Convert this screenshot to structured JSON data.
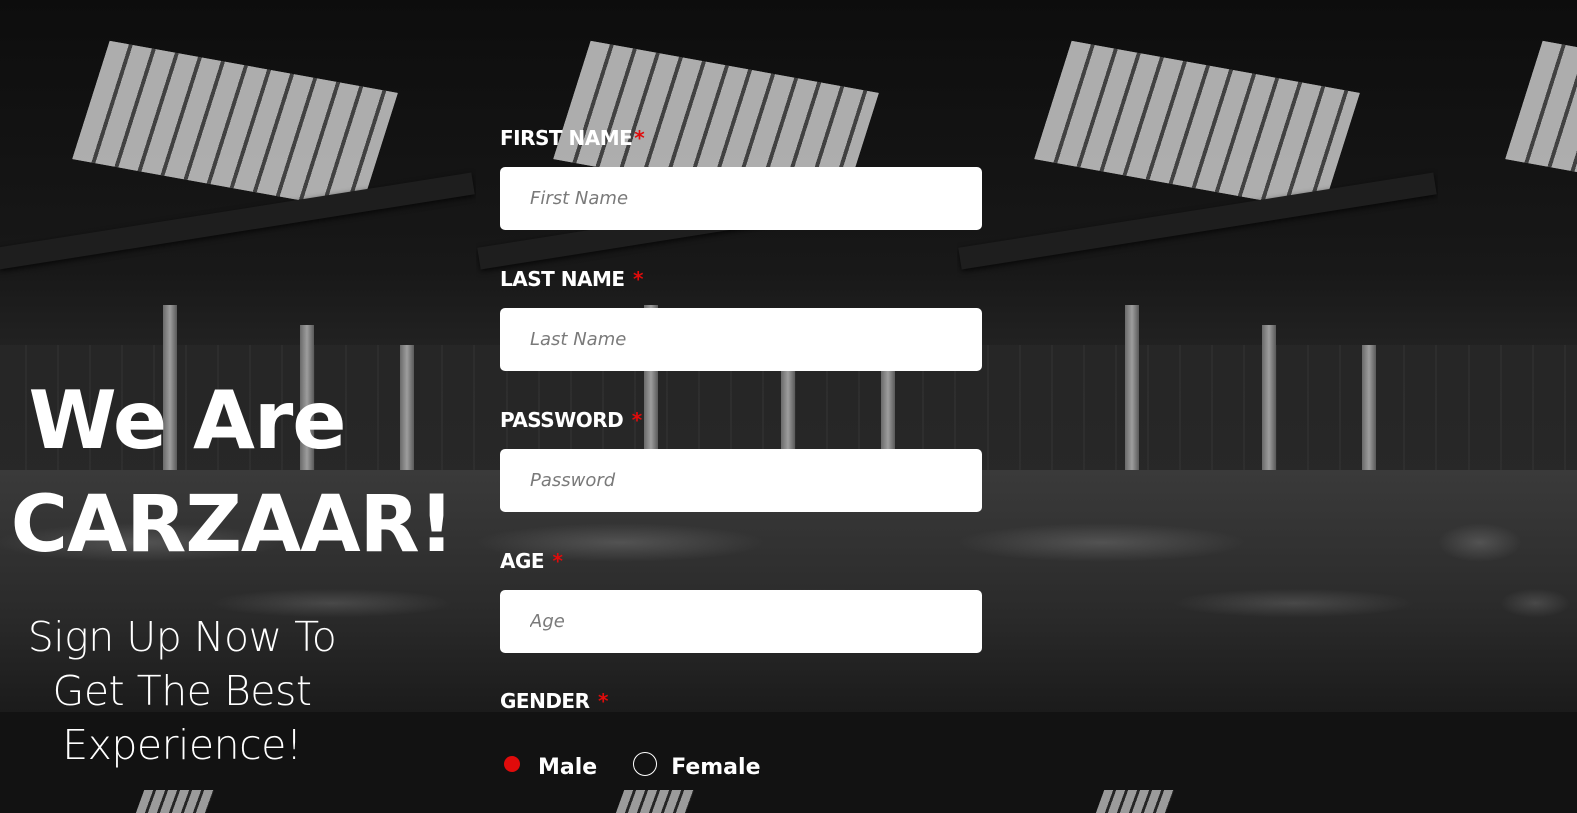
{
  "hero": {
    "title_line1": "We Are",
    "title_line2": "CARZAAR!",
    "subtitle_line1": "Sign Up Now To",
    "subtitle_line2": "Get The Best",
    "subtitle_line3": "Experience!"
  },
  "form": {
    "required_marker": "*",
    "fields": [
      {
        "label": "FIRST NAME",
        "placeholder": "First Name",
        "value": ""
      },
      {
        "label": "LAST NAME",
        "placeholder": "Last Name",
        "value": ""
      },
      {
        "label": "PASSWORD",
        "placeholder": "Password",
        "value": ""
      },
      {
        "label": "AGE",
        "placeholder": "Age",
        "value": ""
      }
    ],
    "gender": {
      "label": "GENDER",
      "options": [
        {
          "label": "Male",
          "selected": true
        },
        {
          "label": "Female",
          "selected": false
        }
      ]
    }
  },
  "colors": {
    "accent_red": "#e00b0b",
    "input_background": "#ffffff",
    "text": "#ffffff",
    "background": "#141414"
  }
}
